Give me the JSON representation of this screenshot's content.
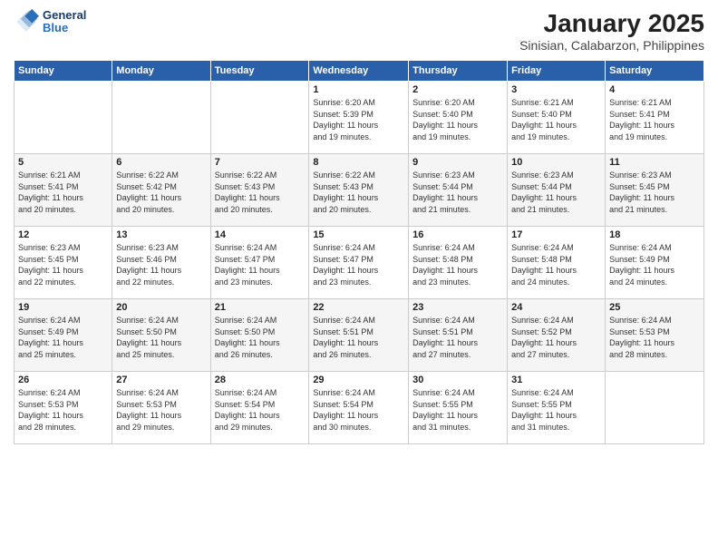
{
  "logo": {
    "general": "General",
    "blue": "Blue"
  },
  "title": "January 2025",
  "subtitle": "Sinisian, Calabarzon, Philippines",
  "weekdays": [
    "Sunday",
    "Monday",
    "Tuesday",
    "Wednesday",
    "Thursday",
    "Friday",
    "Saturday"
  ],
  "weeks": [
    [
      {
        "day": "",
        "info": ""
      },
      {
        "day": "",
        "info": ""
      },
      {
        "day": "",
        "info": ""
      },
      {
        "day": "1",
        "info": "Sunrise: 6:20 AM\nSunset: 5:39 PM\nDaylight: 11 hours\nand 19 minutes."
      },
      {
        "day": "2",
        "info": "Sunrise: 6:20 AM\nSunset: 5:40 PM\nDaylight: 11 hours\nand 19 minutes."
      },
      {
        "day": "3",
        "info": "Sunrise: 6:21 AM\nSunset: 5:40 PM\nDaylight: 11 hours\nand 19 minutes."
      },
      {
        "day": "4",
        "info": "Sunrise: 6:21 AM\nSunset: 5:41 PM\nDaylight: 11 hours\nand 19 minutes."
      }
    ],
    [
      {
        "day": "5",
        "info": "Sunrise: 6:21 AM\nSunset: 5:41 PM\nDaylight: 11 hours\nand 20 minutes."
      },
      {
        "day": "6",
        "info": "Sunrise: 6:22 AM\nSunset: 5:42 PM\nDaylight: 11 hours\nand 20 minutes."
      },
      {
        "day": "7",
        "info": "Sunrise: 6:22 AM\nSunset: 5:43 PM\nDaylight: 11 hours\nand 20 minutes."
      },
      {
        "day": "8",
        "info": "Sunrise: 6:22 AM\nSunset: 5:43 PM\nDaylight: 11 hours\nand 20 minutes."
      },
      {
        "day": "9",
        "info": "Sunrise: 6:23 AM\nSunset: 5:44 PM\nDaylight: 11 hours\nand 21 minutes."
      },
      {
        "day": "10",
        "info": "Sunrise: 6:23 AM\nSunset: 5:44 PM\nDaylight: 11 hours\nand 21 minutes."
      },
      {
        "day": "11",
        "info": "Sunrise: 6:23 AM\nSunset: 5:45 PM\nDaylight: 11 hours\nand 21 minutes."
      }
    ],
    [
      {
        "day": "12",
        "info": "Sunrise: 6:23 AM\nSunset: 5:45 PM\nDaylight: 11 hours\nand 22 minutes."
      },
      {
        "day": "13",
        "info": "Sunrise: 6:23 AM\nSunset: 5:46 PM\nDaylight: 11 hours\nand 22 minutes."
      },
      {
        "day": "14",
        "info": "Sunrise: 6:24 AM\nSunset: 5:47 PM\nDaylight: 11 hours\nand 23 minutes."
      },
      {
        "day": "15",
        "info": "Sunrise: 6:24 AM\nSunset: 5:47 PM\nDaylight: 11 hours\nand 23 minutes."
      },
      {
        "day": "16",
        "info": "Sunrise: 6:24 AM\nSunset: 5:48 PM\nDaylight: 11 hours\nand 23 minutes."
      },
      {
        "day": "17",
        "info": "Sunrise: 6:24 AM\nSunset: 5:48 PM\nDaylight: 11 hours\nand 24 minutes."
      },
      {
        "day": "18",
        "info": "Sunrise: 6:24 AM\nSunset: 5:49 PM\nDaylight: 11 hours\nand 24 minutes."
      }
    ],
    [
      {
        "day": "19",
        "info": "Sunrise: 6:24 AM\nSunset: 5:49 PM\nDaylight: 11 hours\nand 25 minutes."
      },
      {
        "day": "20",
        "info": "Sunrise: 6:24 AM\nSunset: 5:50 PM\nDaylight: 11 hours\nand 25 minutes."
      },
      {
        "day": "21",
        "info": "Sunrise: 6:24 AM\nSunset: 5:50 PM\nDaylight: 11 hours\nand 26 minutes."
      },
      {
        "day": "22",
        "info": "Sunrise: 6:24 AM\nSunset: 5:51 PM\nDaylight: 11 hours\nand 26 minutes."
      },
      {
        "day": "23",
        "info": "Sunrise: 6:24 AM\nSunset: 5:51 PM\nDaylight: 11 hours\nand 27 minutes."
      },
      {
        "day": "24",
        "info": "Sunrise: 6:24 AM\nSunset: 5:52 PM\nDaylight: 11 hours\nand 27 minutes."
      },
      {
        "day": "25",
        "info": "Sunrise: 6:24 AM\nSunset: 5:53 PM\nDaylight: 11 hours\nand 28 minutes."
      }
    ],
    [
      {
        "day": "26",
        "info": "Sunrise: 6:24 AM\nSunset: 5:53 PM\nDaylight: 11 hours\nand 28 minutes."
      },
      {
        "day": "27",
        "info": "Sunrise: 6:24 AM\nSunset: 5:53 PM\nDaylight: 11 hours\nand 29 minutes."
      },
      {
        "day": "28",
        "info": "Sunrise: 6:24 AM\nSunset: 5:54 PM\nDaylight: 11 hours\nand 29 minutes."
      },
      {
        "day": "29",
        "info": "Sunrise: 6:24 AM\nSunset: 5:54 PM\nDaylight: 11 hours\nand 30 minutes."
      },
      {
        "day": "30",
        "info": "Sunrise: 6:24 AM\nSunset: 5:55 PM\nDaylight: 11 hours\nand 31 minutes."
      },
      {
        "day": "31",
        "info": "Sunrise: 6:24 AM\nSunset: 5:55 PM\nDaylight: 11 hours\nand 31 minutes."
      },
      {
        "day": "",
        "info": ""
      }
    ]
  ]
}
